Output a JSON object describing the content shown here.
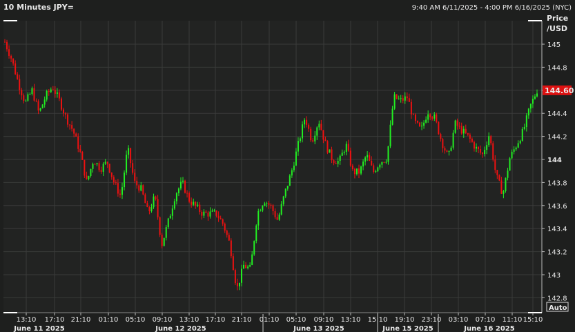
{
  "header": {
    "title": "10 Minutes JPY=",
    "range": "9:40 AM 6/11/2025 - 4:00 PM 6/16/2025 (NYC)"
  },
  "axis": {
    "price_label_1": "Price",
    "price_label_2": "/USD",
    "auto_label": "Auto"
  },
  "colors": {
    "up": "#22ee22",
    "down": "#ee1111",
    "background": "#1e1f1e",
    "plot": "#222322",
    "grid": "#3a3b3a",
    "last_price_tag": "#dd1111"
  },
  "chart_data": {
    "type": "candlestick",
    "title": "10 Minutes JPY=",
    "ylabel": "Price /USD",
    "ylim": [
      142.73,
      145.2
    ],
    "yticks": [
      145,
      144.8,
      144.6,
      144.4,
      144.2,
      144,
      143.8,
      143.6,
      143.4,
      143.2,
      143,
      142.8
    ],
    "ytick_labels": [
      "145",
      "144.8",
      "",
      "144.4",
      "144.2",
      "144",
      "143.8",
      "143.6",
      "143.4",
      "143.2",
      "143",
      "142.8"
    ],
    "last_price": "144.60",
    "xticks": [
      "13:10",
      "17:10",
      "21:10",
      "01:10",
      "05:10",
      "09:10",
      "13:10",
      "17:10",
      "21:10",
      "01:10",
      "05:10",
      "09:10",
      "13:10",
      "15:10",
      "19:10",
      "23:10",
      "03:10",
      "07:10",
      "11:10",
      "15:10"
    ],
    "days": [
      "June 11 2025",
      "June 12 2025",
      "June 13 2025",
      "June 15 2025",
      "June 16 2025"
    ],
    "approx_close_path": [
      145.02,
      144.87,
      144.66,
      144.49,
      144.6,
      144.4,
      144.55,
      144.63,
      144.51,
      144.36,
      144.25,
      144.07,
      143.8,
      144.0,
      143.92,
      143.98,
      143.8,
      143.68,
      144.1,
      143.8,
      143.74,
      143.53,
      143.68,
      143.26,
      143.47,
      143.7,
      143.8,
      143.65,
      143.59,
      143.53,
      143.53,
      143.53,
      143.44,
      143.26,
      142.87,
      143.08,
      143.05,
      143.53,
      143.65,
      143.59,
      143.47,
      143.7,
      143.89,
      144.13,
      144.37,
      144.16,
      144.34,
      144.13,
      144.0,
      143.98,
      144.13,
      143.89,
      143.89,
      144.04,
      143.89,
      143.98,
      144.01,
      144.54,
      144.51,
      144.54,
      144.33,
      144.25,
      144.42,
      144.36,
      144.16,
      144.01,
      144.31,
      144.25,
      144.19,
      144.1,
      144.04,
      144.22,
      143.86,
      143.7,
      144.01,
      144.13,
      144.25,
      144.46,
      144.6
    ]
  }
}
